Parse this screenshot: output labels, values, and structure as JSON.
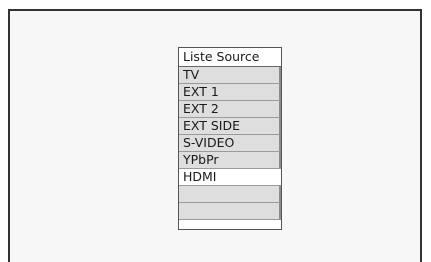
{
  "menu": {
    "title": "Liste Source",
    "items": [
      {
        "label": "TV",
        "selected": false
      },
      {
        "label": "EXT 1",
        "selected": false
      },
      {
        "label": "EXT 2",
        "selected": false
      },
      {
        "label": "EXT SIDE",
        "selected": false
      },
      {
        "label": "S-VIDEO",
        "selected": false
      },
      {
        "label": "YPbPr",
        "selected": false
      },
      {
        "label": "HDMI",
        "selected": true
      }
    ],
    "colors": {
      "item_bg": "#dedede",
      "selected_bg": "#ffffff",
      "frame": "#333333"
    }
  }
}
